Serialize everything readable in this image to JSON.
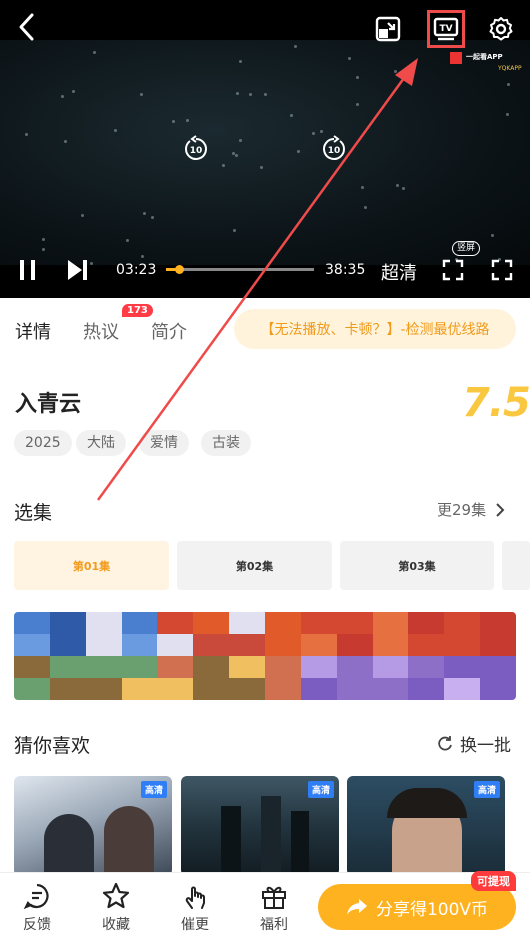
{
  "player": {
    "current_time": "03:23",
    "total_time": "38:35",
    "quality_label": "超清",
    "rewind_label": "10",
    "forward_label": "10",
    "vertical_label": "竖屏",
    "tv_label": "TV",
    "watermark_line1": "一起看APP",
    "watermark_line2": "YQKAPP",
    "progress_fraction": 0.088
  },
  "tabs": [
    {
      "label": "详情",
      "active": true
    },
    {
      "label": "热议",
      "badge": "173"
    },
    {
      "label": "简介"
    }
  ],
  "detect_button": "【无法播放、卡顿？】-检测最优线路",
  "show": {
    "title": "入青云",
    "score": "7.5",
    "tags": [
      "2025",
      "大陆",
      "爱情",
      "古装"
    ]
  },
  "episodes_section": {
    "title": "选集",
    "more": "更29集",
    "episodes": [
      {
        "label": "第01集",
        "active": true
      },
      {
        "label": "第02集"
      },
      {
        "label": "第03集"
      }
    ]
  },
  "recommend_section": {
    "title": "猜你喜欢",
    "refresh": "换一批",
    "hd_badge": "高清"
  },
  "bottom_bar": {
    "feedback": "反馈",
    "favorite": "收藏",
    "urge": "催更",
    "welfare": "福利",
    "share": "分享得100V币",
    "withdraw_badge": "可提现"
  },
  "colors": {
    "accent_orange": "#ffb21f",
    "score_yellow": "#f9c840",
    "badge_red": "#ff3b46",
    "annotation_red": "#f04b4b"
  }
}
